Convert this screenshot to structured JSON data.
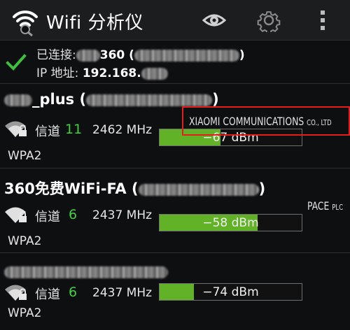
{
  "app": {
    "title": "Wifi 分析仪"
  },
  "actionbar": {
    "view_icon": "eye-icon",
    "settings_icon": "gear-icon",
    "menu_icon": "overflow-menu-icon"
  },
  "connection": {
    "connected_label": "已连接:",
    "ssid_visible": "360 (",
    "ssid_close": ")",
    "ip_label": "IP 地址:",
    "ip_visible": "192.168."
  },
  "colors": {
    "signal_bar": "#62b227",
    "channel": "#40d040",
    "highlight_box": "#e41e1e"
  },
  "networks": [
    {
      "ssid": "_plus (",
      "ssid_close": ")",
      "channel_label": "信道",
      "channel": "11",
      "frequency": "2462 MHz",
      "signal": "−67 dBm",
      "signal_fill": 0.43,
      "security": "WPA2",
      "vendor_main": "XIAOMI COMMUNICATIONS",
      "vendor_suffix": "CO., LTD"
    },
    {
      "ssid": "360免费WiFi-FA (",
      "ssid_close": ")",
      "channel_label": "信道",
      "channel": "6",
      "frequency": "2437 MHz",
      "signal": "−58 dBm",
      "signal_fill": 0.69,
      "security": "WPA2",
      "vendor_main": "PACE",
      "vendor_suffix": "PLC"
    },
    {
      "ssid": "",
      "channel_label": "信道",
      "channel": "6",
      "frequency": "2437 MHz",
      "signal": "−74 dBm",
      "signal_fill": 0.24,
      "security": "WPA2"
    }
  ]
}
